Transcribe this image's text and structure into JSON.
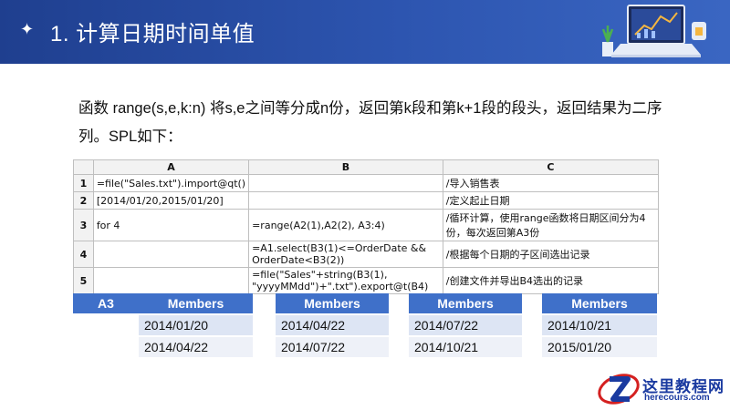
{
  "header": {
    "bullet": "✦",
    "title": "1. 计算日期时间单值"
  },
  "intro": {
    "text": "函数 range(s,e,k:n) 将s,e之间等分成n份，返回第k段和第k+1段的段头，返回结果为二序列。SPL如下："
  },
  "spl_table": {
    "columns": [
      "A",
      "B",
      "C"
    ],
    "rows": [
      {
        "num": "1",
        "a": "=file(\"Sales.txt\").import@qt()",
        "b": "",
        "c": "/导入销售表"
      },
      {
        "num": "2",
        "a": "[2014/01/20,2015/01/20]",
        "b": "",
        "c": "/定义起止日期"
      },
      {
        "num": "3",
        "a": "for 4",
        "b": "=range(A2(1),A2(2), A3:4)",
        "c": "/循环计算，使用range函数将日期区间分为4份，每次返回第A3份"
      },
      {
        "num": "4",
        "a": "",
        "b": "=A1.select(B3(1)<=OrderDate && OrderDate<B3(2))",
        "c": "/根据每个日期的子区间选出记录"
      },
      {
        "num": "5",
        "a": "",
        "b": "=file(\"Sales\"+string(B3(1), \"yyyyMMdd\")+\".txt\").export@t(B4)",
        "c": "/创建文件并导出B4选出的记录"
      }
    ]
  },
  "result_tables": [
    {
      "label": "A3",
      "header": "Members",
      "rows": [
        "2014/01/20",
        "2014/04/22"
      ]
    },
    {
      "header": "Members",
      "rows": [
        "2014/04/22",
        "2014/07/22"
      ]
    },
    {
      "header": "Members",
      "rows": [
        "2014/07/22",
        "2014/10/21"
      ]
    },
    {
      "header": "Members",
      "rows": [
        "2014/10/21",
        "2015/01/20"
      ]
    }
  ],
  "logo": {
    "brand": "这里教程网",
    "site": "herecours.com"
  },
  "colors": {
    "header_bg": "#2d55b0",
    "table_header": "#3f70c9",
    "row_alt": "#dde5f4",
    "logo_red": "#d42020",
    "logo_blue": "#1a3aa0"
  }
}
